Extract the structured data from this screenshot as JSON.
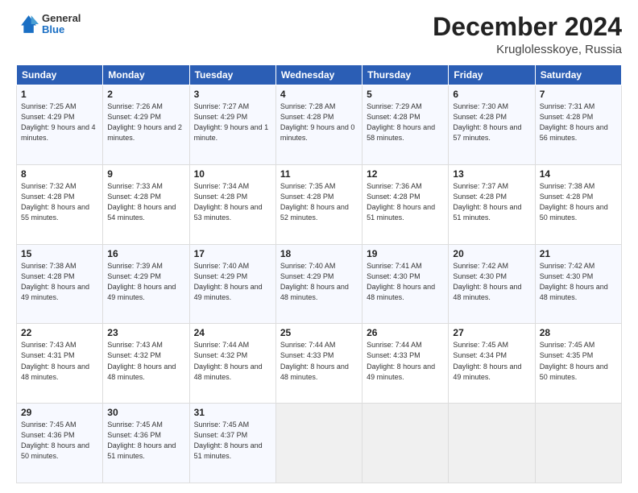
{
  "header": {
    "logo": {
      "general": "General",
      "blue": "Blue"
    },
    "title": "December 2024",
    "location": "Kruglolesskoye, Russia"
  },
  "weekdays": [
    "Sunday",
    "Monday",
    "Tuesday",
    "Wednesday",
    "Thursday",
    "Friday",
    "Saturday"
  ],
  "weeks": [
    [
      {
        "day": 1,
        "sunrise": "7:25 AM",
        "sunset": "4:29 PM",
        "daylight": "9 hours and 4 minutes."
      },
      {
        "day": 2,
        "sunrise": "7:26 AM",
        "sunset": "4:29 PM",
        "daylight": "9 hours and 2 minutes."
      },
      {
        "day": 3,
        "sunrise": "7:27 AM",
        "sunset": "4:29 PM",
        "daylight": "9 hours and 1 minute."
      },
      {
        "day": 4,
        "sunrise": "7:28 AM",
        "sunset": "4:28 PM",
        "daylight": "9 hours and 0 minutes."
      },
      {
        "day": 5,
        "sunrise": "7:29 AM",
        "sunset": "4:28 PM",
        "daylight": "8 hours and 58 minutes."
      },
      {
        "day": 6,
        "sunrise": "7:30 AM",
        "sunset": "4:28 PM",
        "daylight": "8 hours and 57 minutes."
      },
      {
        "day": 7,
        "sunrise": "7:31 AM",
        "sunset": "4:28 PM",
        "daylight": "8 hours and 56 minutes."
      }
    ],
    [
      {
        "day": 8,
        "sunrise": "7:32 AM",
        "sunset": "4:28 PM",
        "daylight": "8 hours and 55 minutes."
      },
      {
        "day": 9,
        "sunrise": "7:33 AM",
        "sunset": "4:28 PM",
        "daylight": "8 hours and 54 minutes."
      },
      {
        "day": 10,
        "sunrise": "7:34 AM",
        "sunset": "4:28 PM",
        "daylight": "8 hours and 53 minutes."
      },
      {
        "day": 11,
        "sunrise": "7:35 AM",
        "sunset": "4:28 PM",
        "daylight": "8 hours and 52 minutes."
      },
      {
        "day": 12,
        "sunrise": "7:36 AM",
        "sunset": "4:28 PM",
        "daylight": "8 hours and 51 minutes."
      },
      {
        "day": 13,
        "sunrise": "7:37 AM",
        "sunset": "4:28 PM",
        "daylight": "8 hours and 51 minutes."
      },
      {
        "day": 14,
        "sunrise": "7:38 AM",
        "sunset": "4:28 PM",
        "daylight": "8 hours and 50 minutes."
      }
    ],
    [
      {
        "day": 15,
        "sunrise": "7:38 AM",
        "sunset": "4:28 PM",
        "daylight": "8 hours and 49 minutes."
      },
      {
        "day": 16,
        "sunrise": "7:39 AM",
        "sunset": "4:29 PM",
        "daylight": "8 hours and 49 minutes."
      },
      {
        "day": 17,
        "sunrise": "7:40 AM",
        "sunset": "4:29 PM",
        "daylight": "8 hours and 49 minutes."
      },
      {
        "day": 18,
        "sunrise": "7:40 AM",
        "sunset": "4:29 PM",
        "daylight": "8 hours and 48 minutes."
      },
      {
        "day": 19,
        "sunrise": "7:41 AM",
        "sunset": "4:30 PM",
        "daylight": "8 hours and 48 minutes."
      },
      {
        "day": 20,
        "sunrise": "7:42 AM",
        "sunset": "4:30 PM",
        "daylight": "8 hours and 48 minutes."
      },
      {
        "day": 21,
        "sunrise": "7:42 AM",
        "sunset": "4:30 PM",
        "daylight": "8 hours and 48 minutes."
      }
    ],
    [
      {
        "day": 22,
        "sunrise": "7:43 AM",
        "sunset": "4:31 PM",
        "daylight": "8 hours and 48 minutes."
      },
      {
        "day": 23,
        "sunrise": "7:43 AM",
        "sunset": "4:32 PM",
        "daylight": "8 hours and 48 minutes."
      },
      {
        "day": 24,
        "sunrise": "7:44 AM",
        "sunset": "4:32 PM",
        "daylight": "8 hours and 48 minutes."
      },
      {
        "day": 25,
        "sunrise": "7:44 AM",
        "sunset": "4:33 PM",
        "daylight": "8 hours and 48 minutes."
      },
      {
        "day": 26,
        "sunrise": "7:44 AM",
        "sunset": "4:33 PM",
        "daylight": "8 hours and 49 minutes."
      },
      {
        "day": 27,
        "sunrise": "7:45 AM",
        "sunset": "4:34 PM",
        "daylight": "8 hours and 49 minutes."
      },
      {
        "day": 28,
        "sunrise": "7:45 AM",
        "sunset": "4:35 PM",
        "daylight": "8 hours and 50 minutes."
      }
    ],
    [
      {
        "day": 29,
        "sunrise": "7:45 AM",
        "sunset": "4:36 PM",
        "daylight": "8 hours and 50 minutes."
      },
      {
        "day": 30,
        "sunrise": "7:45 AM",
        "sunset": "4:36 PM",
        "daylight": "8 hours and 51 minutes."
      },
      {
        "day": 31,
        "sunrise": "7:45 AM",
        "sunset": "4:37 PM",
        "daylight": "8 hours and 51 minutes."
      },
      null,
      null,
      null,
      null
    ]
  ]
}
